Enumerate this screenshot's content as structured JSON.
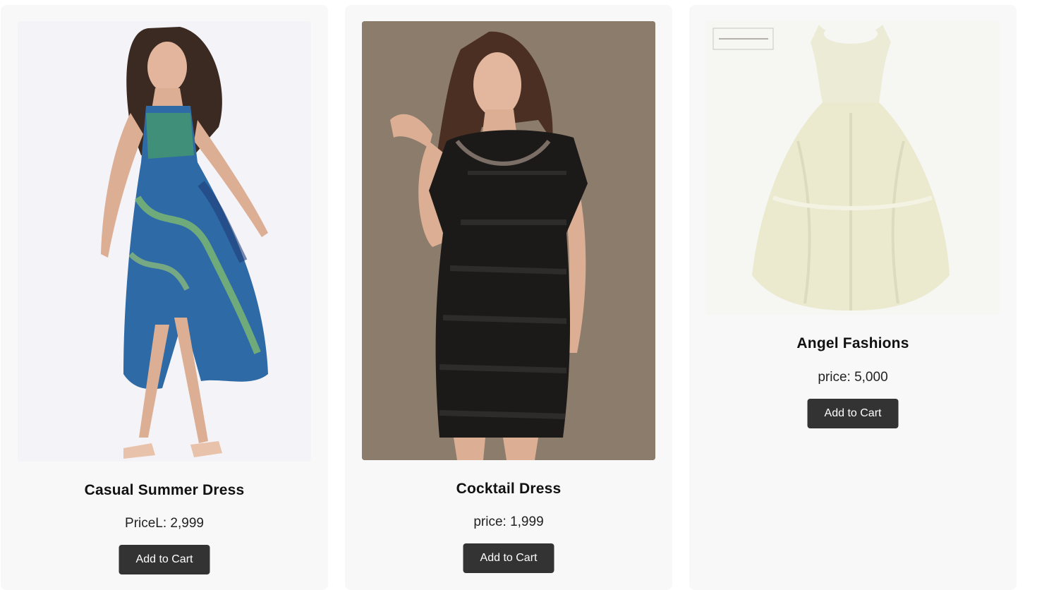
{
  "products": [
    {
      "name": "Casual Summer Dress",
      "price": "PriceL: 2,999",
      "button_label": "Add to Cart",
      "image": "model-in-blue-green-leaf-print-halter-dress-image",
      "image_bg": "#f4f3f7"
    },
    {
      "name": "Cocktail Dress",
      "price": "price: 1,999",
      "button_label": "Add to Cart",
      "image": "model-in-black-satin-cocktail-dress-image",
      "image_bg": "#8c7c6c"
    },
    {
      "name": "Angel Fashions",
      "price": "price: 5,000",
      "button_label": "Add to Cart",
      "image": "cream-lace-sleeveless-dress-image",
      "image_bg": "#f6f6f3"
    }
  ],
  "colors": {
    "card_bg": "#f8f8f8",
    "button_bg": "#333333",
    "button_text": "#ffffff"
  }
}
